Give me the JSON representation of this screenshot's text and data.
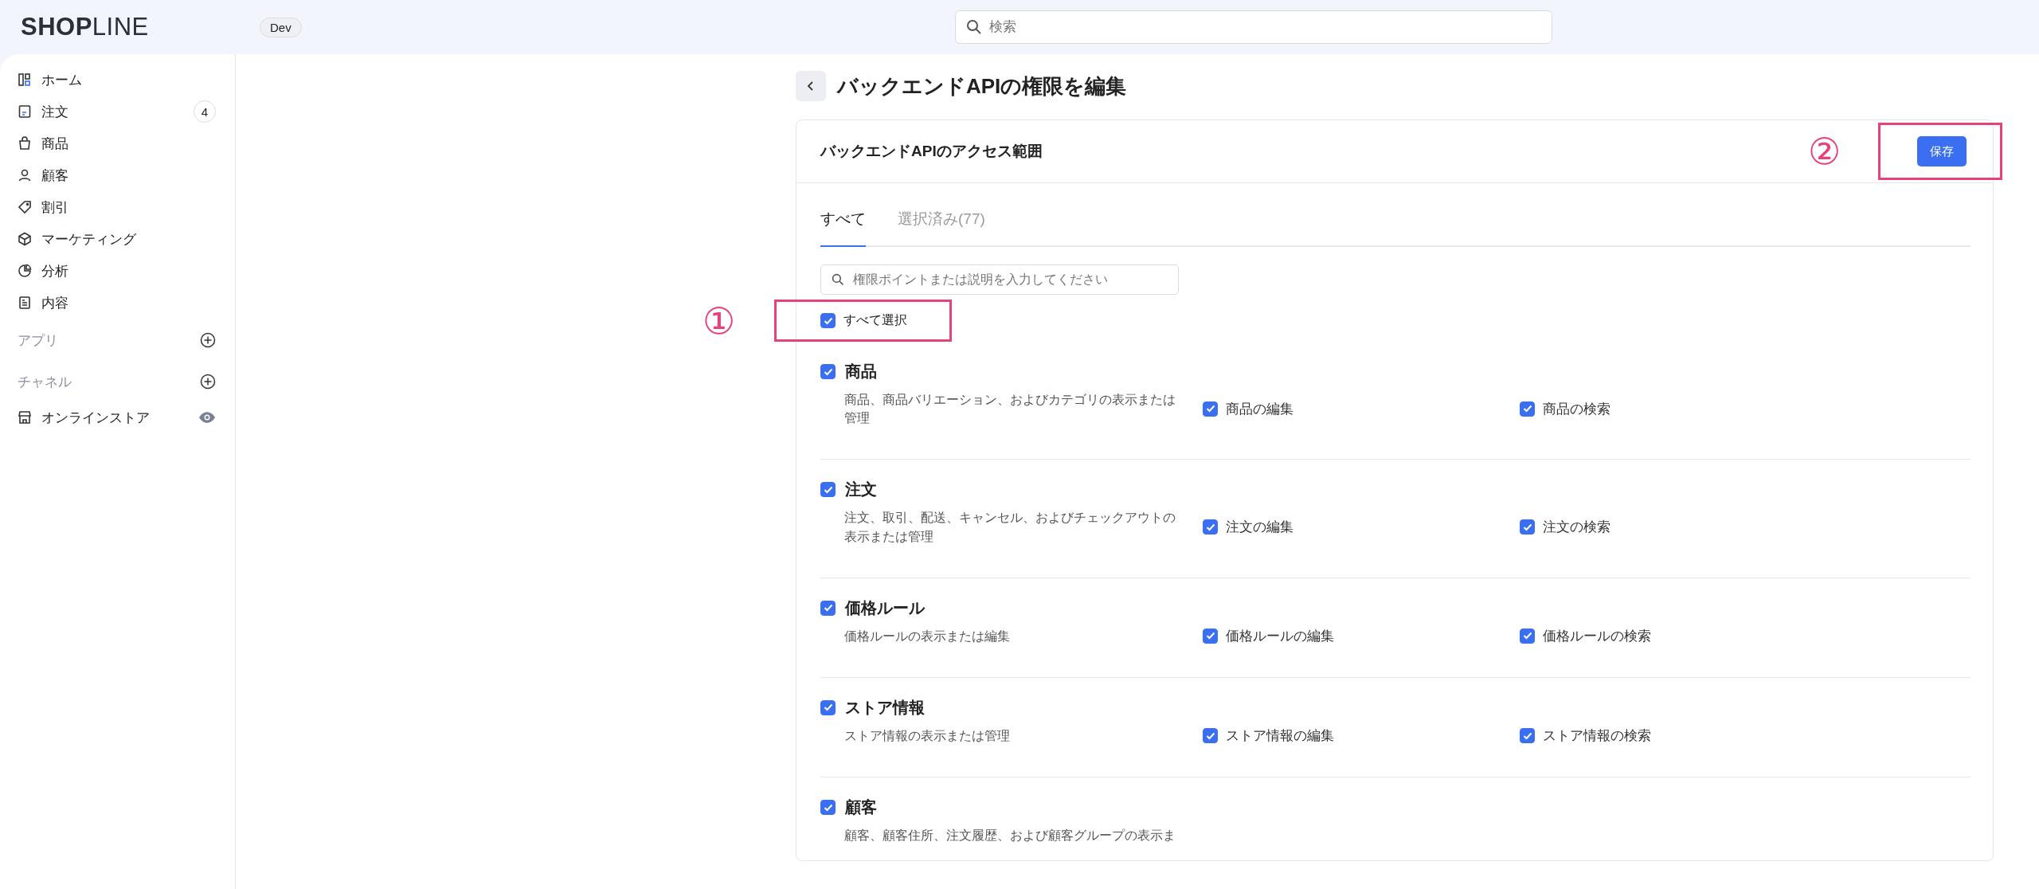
{
  "topbar": {
    "logo": "**SHOP**LINE",
    "env_badge": "Dev",
    "search": {
      "placeholder": "検索"
    }
  },
  "sidebar": {
    "items": [
      {
        "label": "ホーム"
      },
      {
        "label": "注文",
        "badge": "4"
      },
      {
        "label": "商品"
      },
      {
        "label": "顧客"
      },
      {
        "label": "割引"
      },
      {
        "label": "マーケティング"
      },
      {
        "label": "分析"
      },
      {
        "label": "内容"
      }
    ],
    "sections": [
      {
        "label": "アプリ"
      },
      {
        "label": "チャネル",
        "items": [
          {
            "label": "オンラインストア"
          }
        ]
      }
    ]
  },
  "page": {
    "title": "バックエンドAPIの権限を編集",
    "card": {
      "title": "バックエンドAPIのアクセス範囲",
      "save_button": "保存",
      "tabs": [
        {
          "label": "すべて",
          "selected": true
        },
        {
          "label": "選択済み(77)",
          "selected": false
        }
      ],
      "filter": {
        "placeholder": "権限ポイントまたは説明を入力してください"
      },
      "select_all": {
        "label": "すべて選択",
        "checked": true
      },
      "groups": [
        {
          "title": "商品",
          "checked": true,
          "description": "商品、商品バリエーション、およびカテゴリの表示または管理",
          "permissions": [
            {
              "label": "商品の編集",
              "checked": true
            },
            {
              "label": "商品の検索",
              "checked": true
            }
          ]
        },
        {
          "title": "注文",
          "checked": true,
          "description": "注文、取引、配送、キャンセル、およびチェックアウトの表示または管理",
          "permissions": [
            {
              "label": "注文の編集",
              "checked": true
            },
            {
              "label": "注文の検索",
              "checked": true
            }
          ]
        },
        {
          "title": "価格ルール",
          "checked": true,
          "description": "価格ルールの表示または編集",
          "permissions": [
            {
              "label": "価格ルールの編集",
              "checked": true
            },
            {
              "label": "価格ルールの検索",
              "checked": true
            }
          ]
        },
        {
          "title": "ストア情報",
          "checked": true,
          "description": "ストア情報の表示または管理",
          "permissions": [
            {
              "label": "ストア情報の編集",
              "checked": true
            },
            {
              "label": "ストア情報の検索",
              "checked": true
            }
          ]
        },
        {
          "title": "顧客",
          "checked": true,
          "description": "顧客、顧客住所、注文履歴、および顧客グループの表示ま"
        }
      ]
    }
  },
  "annotations": [
    {
      "label": "①"
    },
    {
      "label": "②"
    }
  ]
}
